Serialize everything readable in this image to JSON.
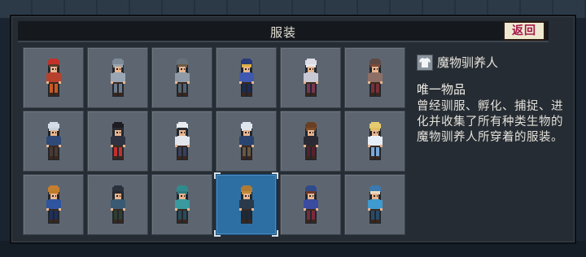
{
  "header": {
    "title": "服装",
    "back_label": "返回"
  },
  "costumes": [
    {
      "label": "wizard-costume",
      "hair": "#5a3a2a",
      "hat": "#c2312a",
      "body": "#b8412e",
      "legs": "#c85a20",
      "skin": "#e8b58f",
      "selected": false
    },
    {
      "label": "knight-costume",
      "hair": "#9aa4ae",
      "hat": "#7d8a98",
      "body": "#9aa6b4",
      "legs": "#6d7888",
      "skin": "#e8b58f",
      "selected": false
    },
    {
      "label": "ranger-costume",
      "hair": "#6a5a4a",
      "hat": "#66707a",
      "body": "#8f9aa6",
      "legs": "#55606c",
      "skin": "#e8b58f",
      "selected": false
    },
    {
      "label": "musketeer-costume",
      "hair": "#e0b040",
      "hat": "#2a3b7a",
      "body": "#3f58b0",
      "legs": "#1d2a55",
      "skin": "#e8b58f",
      "selected": false
    },
    {
      "label": "nun-costume",
      "hair": "#e9e9ef",
      "hat": "#dcdce6",
      "body": "#c9c9d6",
      "legs": "#7a3550",
      "skin": "#e8b58f",
      "selected": false
    },
    {
      "label": "traveler-costume",
      "hair": "#7a4a3a",
      "hat": "#5d4a44",
      "body": "#8e6f66",
      "legs": "#7a2f35",
      "skin": "#e8b58f",
      "selected": false
    },
    {
      "label": "hooded-blue-costume",
      "hair": "#c8d4e0",
      "hat": "#d4dde8",
      "body": "#2f4a78",
      "legs": "#4a3a32",
      "skin": "#e8b58f",
      "selected": false
    },
    {
      "label": "gentleman-costume",
      "hair": "#2a2a30",
      "hat": "#1c1c22",
      "body": "#2e3240",
      "legs": "#c23030",
      "skin": "#e8b58f",
      "selected": false
    },
    {
      "label": "chef-costume",
      "hair": "#2a2a30",
      "hat": "#e8ecf0",
      "body": "#e2e6ec",
      "legs": "#3a3f5a",
      "skin": "#e8b58f",
      "selected": false
    },
    {
      "label": "parka-costume",
      "hair": "#e0e6ee",
      "hat": "#dfe6ee",
      "body": "#2a4470",
      "legs": "#6a5640",
      "skin": "#e8b58f",
      "selected": false
    },
    {
      "label": "maid-costume",
      "hair": "#7a4a2a",
      "hat": "#6a3f24",
      "body": "#2a2a34",
      "legs": "#5a1f2c",
      "skin": "#e8b58f",
      "selected": false
    },
    {
      "label": "princess-costume",
      "hair": "#e0c060",
      "hat": "#e6cc70",
      "body": "#e8eef8",
      "legs": "#7aa6d6",
      "skin": "#e8b58f",
      "selected": false
    },
    {
      "label": "fighter-costume",
      "hair": "#c07a2a",
      "hat": "#c47e30",
      "body": "#2f55a0",
      "legs": "#1f2f5a",
      "skin": "#e8b58f",
      "selected": false
    },
    {
      "label": "gunslinger-costume",
      "hair": "#2a2a30",
      "hat": "#2a303c",
      "body": "#3a5a74",
      "legs": "#2f3e2f",
      "skin": "#e8b58f",
      "selected": false
    },
    {
      "label": "mage-teal-costume",
      "hair": "#2f7a7e",
      "hat": "#2f8a8e",
      "body": "#3a9aa0",
      "legs": "#2a4a58",
      "skin": "#e8b58f",
      "selected": false
    },
    {
      "label": "tamer-costume",
      "hair": "#c08a3a",
      "hat": "#b07a34",
      "body": "#2a3a4a",
      "legs": "#1f2a38",
      "skin": "#e8b58f",
      "selected": true
    },
    {
      "label": "adventurer-costume",
      "hair": "#6a3a2a",
      "hat": "#2f4a8a",
      "body": "#3a4ca0",
      "legs": "#7a2a3a",
      "skin": "#e8b58f",
      "selected": false
    },
    {
      "label": "priest-costume",
      "hair": "#e8dcc0",
      "hat": "#3a7ab0",
      "body": "#3f9ad0",
      "legs": "#2a4a68",
      "skin": "#e8b58f",
      "selected": false
    }
  ],
  "detail": {
    "icon": "shirt-icon",
    "name": "魔物驯养人",
    "kind": "唯一物品",
    "description": "曾经驯服、孵化、捕捉、进化并收集了所有种类生物的魔物驯养人所穿着的服装。"
  }
}
